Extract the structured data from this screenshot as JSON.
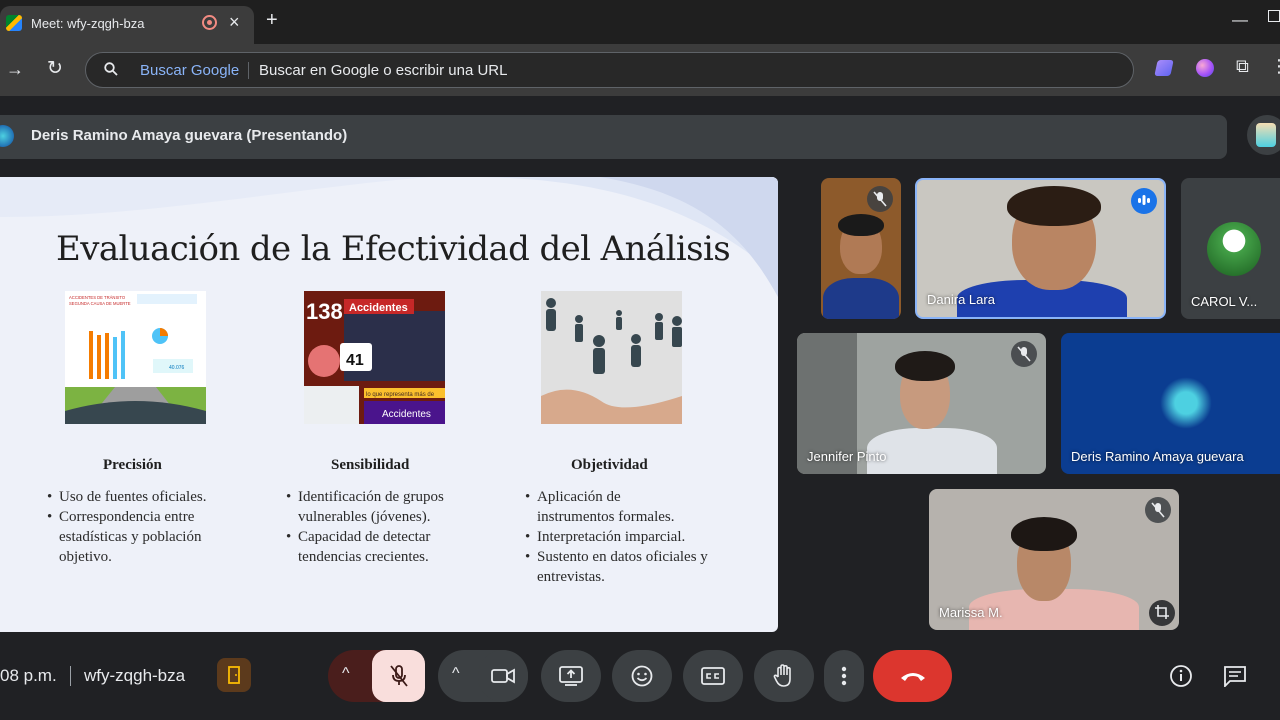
{
  "browser": {
    "tab_title": "Meet: wfy-zqgh-bza",
    "omnibox_engine": "Buscar Google",
    "omnibox_placeholder": "Buscar en Google o escribir una URL"
  },
  "meet": {
    "presenter_label": "Deris Ramino Amaya guevara (Presentando)",
    "slide": {
      "title": "Evaluación de la Efectividad del Análisis",
      "columns": [
        {
          "heading": "Precisión",
          "bullets": [
            "Uso de fuentes oficiales.",
            "Correspondencia entre estadísticas y población objetivo."
          ],
          "image_text": [
            "ACCIDENTES DE TRÁNSITO",
            "SEGUNDA CAUSA DE MUERTE",
            "40.076"
          ]
        },
        {
          "heading": "Sensibilidad",
          "bullets": [
            "Identificación de grupos vulnerables (jóvenes).",
            "Capacidad de detectar tendencias crecientes."
          ],
          "image_text": [
            "138",
            "Accidentes",
            "41",
            "lo que representa más de",
            "Accidentes"
          ]
        },
        {
          "heading": "Objetividad",
          "bullets": [
            "Aplicación de instrumentos formales.",
            "Interpretación imparcial.",
            "Sustento en datos oficiales y entrevistas."
          ]
        }
      ]
    },
    "participants": [
      {
        "name": "",
        "muted": true
      },
      {
        "name": "Danira Lara",
        "speaking": true
      },
      {
        "name": "CAROL V..."
      },
      {
        "name": "Jennifer Pinto",
        "muted": true
      },
      {
        "name": "Deris Ramino Amaya guevara"
      },
      {
        "name": "Marissa M.",
        "muted": true
      }
    ],
    "bottom": {
      "time": "08 p.m.",
      "meeting_code": "wfy-zqgh-bza"
    }
  }
}
